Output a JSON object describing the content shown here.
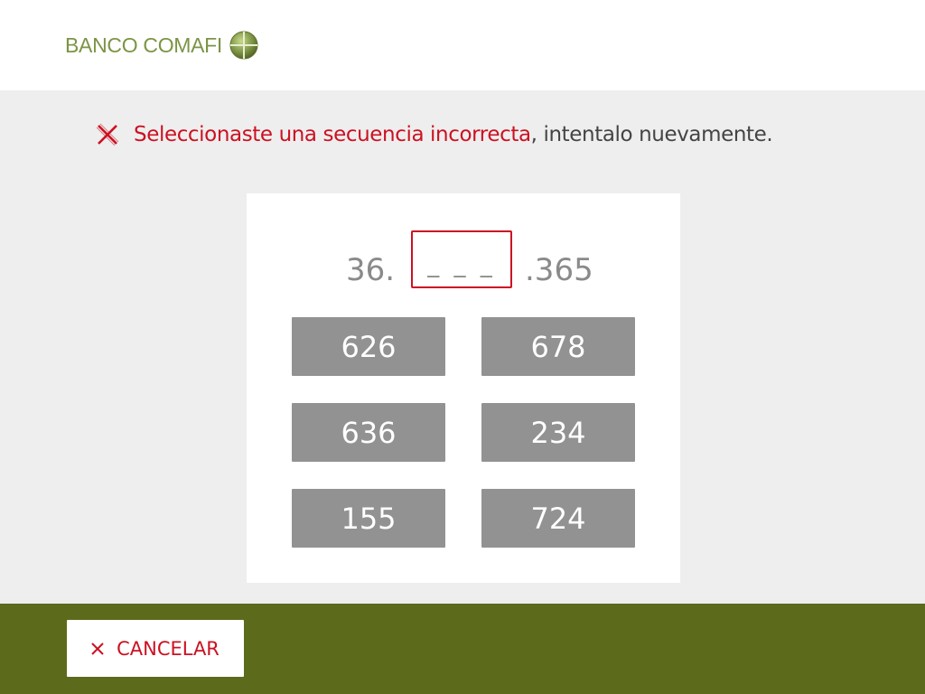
{
  "header": {
    "brand": "BANCO COMAFI",
    "brand_color": "#7c9445"
  },
  "message": {
    "error_text": "Seleccionaste una secuencia incorrecta",
    "rest_text": ", intentalo nuevamente.",
    "icon": "error-x-icon",
    "error_color": "#cc1122"
  },
  "sequence": {
    "prefix": "36.",
    "placeholder": "_ _ _",
    "suffix": ".365"
  },
  "options": [
    "626",
    "678",
    "636",
    "234",
    "155",
    "724"
  ],
  "footer": {
    "cancel_label": "CANCELAR",
    "cancel_icon": "close-icon",
    "background": "#5b6b1b"
  }
}
